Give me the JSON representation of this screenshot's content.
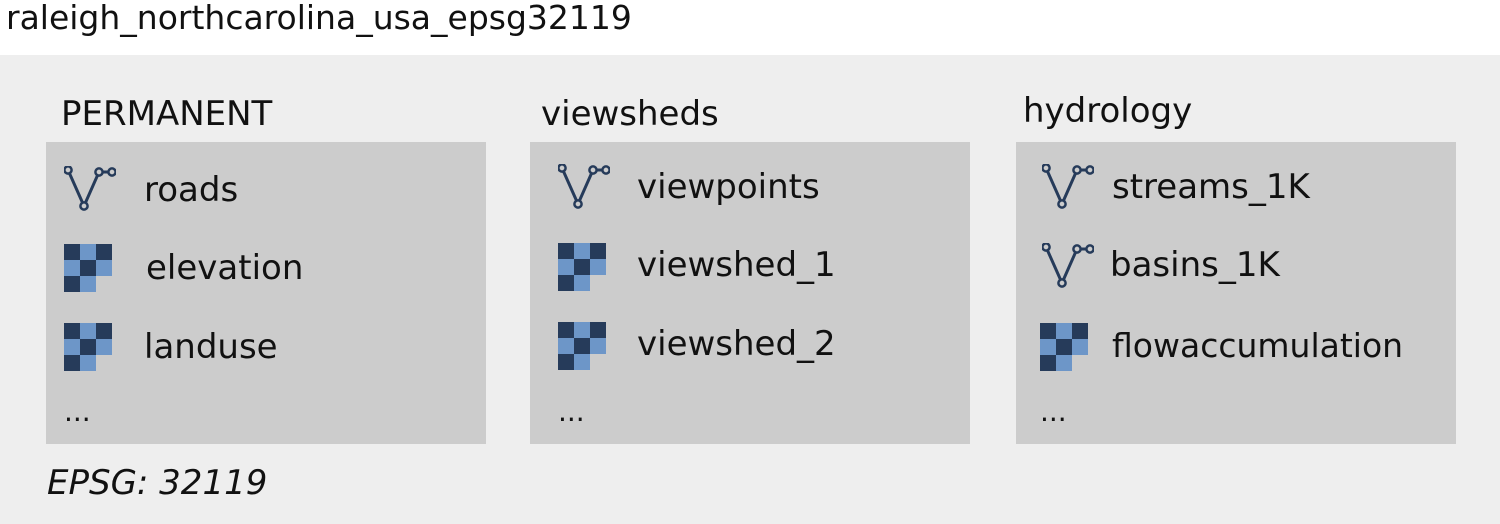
{
  "location": {
    "title": "raleigh_northcarolina_usa_epsg32119",
    "projection": "EPSG: 32119"
  },
  "colors": {
    "location_bg": "#eeeeee",
    "panel_bg": "#cccccc",
    "raster_dark": "#263b5a",
    "raster_light": "#6d96c8",
    "vector_stroke": "#263b5a"
  },
  "icons": {
    "vector": "vector-icon",
    "raster": "raster-icon"
  },
  "mapsets": [
    {
      "name": "PERMANENT",
      "layers": [
        {
          "label": "roads",
          "type": "vector"
        },
        {
          "label": "elevation",
          "type": "raster"
        },
        {
          "label": "landuse",
          "type": "raster"
        }
      ],
      "more": "..."
    },
    {
      "name": "viewsheds",
      "layers": [
        {
          "label": "viewpoints",
          "type": "vector"
        },
        {
          "label": "viewshed_1",
          "type": "raster"
        },
        {
          "label": "viewshed_2",
          "type": "raster"
        }
      ],
      "more": "..."
    },
    {
      "name": "hydrology",
      "layers": [
        {
          "label": "streams_1K",
          "type": "vector"
        },
        {
          "label": "basins_1K",
          "type": "vector"
        },
        {
          "label": "flowaccumulation",
          "type": "raster"
        }
      ],
      "more": "..."
    }
  ]
}
